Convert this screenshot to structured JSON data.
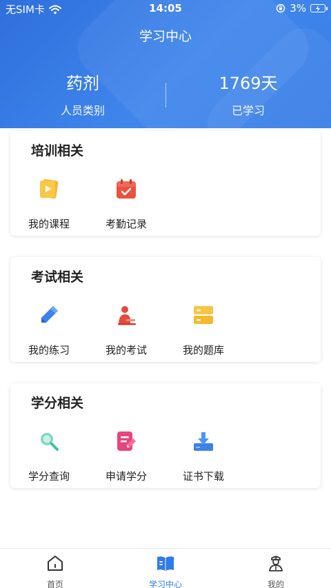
{
  "status_bar": {
    "carrier": "无SIM卡",
    "time": "14:05",
    "battery": "3%"
  },
  "header": {
    "title": "学习中心",
    "stats": [
      {
        "value": "药剂",
        "label": "人员类别"
      },
      {
        "value": "1769天",
        "label": "已学习"
      }
    ]
  },
  "sections": [
    {
      "title": "培训相关",
      "items": [
        {
          "label": "我的课程",
          "icon": "play-video-icon"
        },
        {
          "label": "考勤记录",
          "icon": "calendar-check-icon"
        }
      ]
    },
    {
      "title": "考试相关",
      "items": [
        {
          "label": "我的练习",
          "icon": "pencil-icon"
        },
        {
          "label": "我的考试",
          "icon": "exam-person-icon"
        },
        {
          "label": "我的题库",
          "icon": "question-bank-icon"
        }
      ]
    },
    {
      "title": "学分相关",
      "items": [
        {
          "label": "学分查询",
          "icon": "search-icon"
        },
        {
          "label": "申请学分",
          "icon": "apply-form-icon"
        },
        {
          "label": "证书下载",
          "icon": "download-icon"
        }
      ]
    }
  ],
  "tabbar": {
    "items": [
      {
        "label": "首页",
        "icon": "home-icon"
      },
      {
        "label": "学习中心",
        "icon": "book-icon",
        "active": true
      },
      {
        "label": "我的",
        "icon": "doctor-profile-icon"
      }
    ],
    "active_color": "#2f7bea"
  },
  "colors": {
    "header_blue": "#3a7fe6"
  }
}
